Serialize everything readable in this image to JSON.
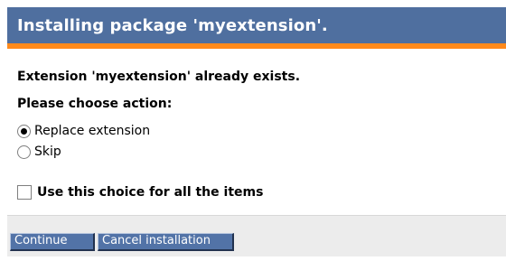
{
  "dialog": {
    "title": "Installing package 'myextension'.",
    "message": "Extension 'myextension' already exists.",
    "prompt": "Please choose action:",
    "options": [
      {
        "label": "Replace extension",
        "selected": true
      },
      {
        "label": "Skip",
        "selected": false
      }
    ],
    "apply_all": {
      "label": "Use this choice for all the items",
      "checked": false
    },
    "buttons": {
      "continue": "Continue",
      "cancel": "Cancel installation"
    }
  },
  "colors": {
    "title_bar": "#4f6f9f",
    "accent": "#ff8a1c",
    "button": "#5273a7",
    "footer": "#ececec"
  }
}
